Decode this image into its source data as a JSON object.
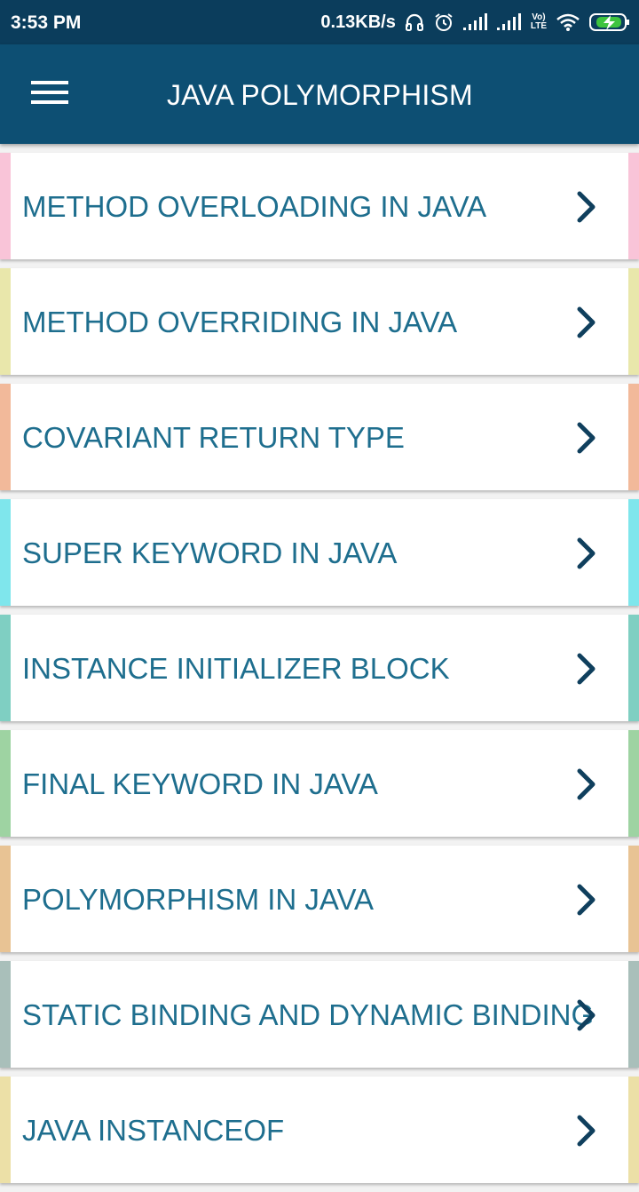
{
  "status_bar": {
    "time": "3:53 PM",
    "net_speed": "0.13KB/s",
    "volte_top": "Vo)",
    "volte_bottom": "LTE",
    "icons": [
      "headphones-icon",
      "alarm-icon",
      "signal-icon",
      "signal-icon",
      "volte-icon",
      "wifi-icon",
      "battery-charging-icon"
    ]
  },
  "app_bar": {
    "title": "JAVA POLYMORPHISM",
    "menu_icon": "hamburger-menu-icon"
  },
  "items": [
    {
      "label": "METHOD OVERLOADING IN JAVA",
      "color": "#f9c4d8"
    },
    {
      "label": "METHOD OVERRIDING IN JAVA",
      "color": "#e9e7ab"
    },
    {
      "label": "COVARIANT RETURN TYPE",
      "color": "#f2b99a"
    },
    {
      "label": "SUPER KEYWORD IN JAVA",
      "color": "#7fe6ec"
    },
    {
      "label": "INSTANCE INITIALIZER BLOCK",
      "color": "#7fcfc2"
    },
    {
      "label": "FINAL KEYWORD IN JAVA",
      "color": "#9ed3a2"
    },
    {
      "label": "POLYMORPHISM IN JAVA",
      "color": "#e8c394"
    },
    {
      "label": "STATIC BINDING AND DYNAMIC BINDING",
      "color": "#a9bfba"
    },
    {
      "label": "JAVA INSTANCEOF",
      "color": "#ece0a7"
    }
  ],
  "colors": {
    "status_bar": "#0b3d5c",
    "app_bar": "#0d4f73",
    "item_text": "#1e6e8e",
    "chevron": "#0f3f5d"
  }
}
